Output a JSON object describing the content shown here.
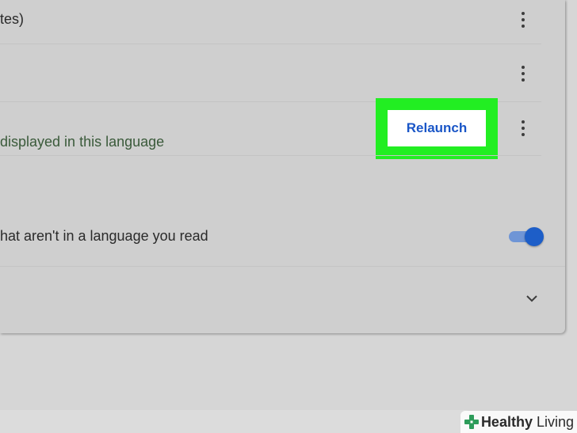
{
  "rows": [
    {
      "text": "tes)"
    },
    {
      "text": ""
    },
    {
      "text": "displayed in this language"
    },
    {
      "text": "hat aren't in a language you read"
    }
  ],
  "relaunch_button": {
    "label": "Relaunch"
  },
  "highlight_color": "#22ee22",
  "toggle": {
    "state": "on",
    "color": "#1d5ec8"
  },
  "icons": {
    "more": "more-vert-icon",
    "expand": "chevron-down-icon",
    "brand": "healthy-living-cross-icon"
  },
  "watermark": {
    "bold": "Healthy",
    "light": "Living"
  }
}
